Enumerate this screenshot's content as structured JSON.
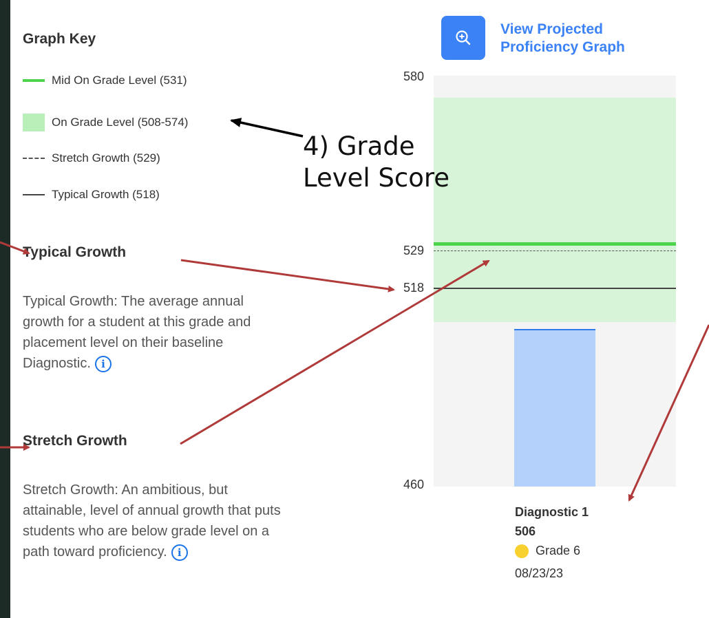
{
  "graph_key": {
    "title": "Graph Key",
    "items": [
      {
        "label": "Mid On Grade Level (531)",
        "swatch": "solid-green"
      },
      {
        "label": "On Grade Level (508-574)",
        "swatch": "green-box"
      },
      {
        "label": "Stretch Growth (529)",
        "swatch": "dashed"
      },
      {
        "label": "Typical Growth (518)",
        "swatch": "solid-dark"
      }
    ]
  },
  "sections": {
    "typical": {
      "title": "Typical Growth",
      "description": "Typical Growth: The average annual growth for a student at this grade and placement level on their baseline Diagnostic."
    },
    "stretch": {
      "title": "Stretch Growth",
      "description": "Stretch Growth: An ambitious, but attainable, level of annual growth that puts students who are below grade level on a path toward proficiency."
    }
  },
  "view_button": {
    "label": "View Projected Proficiency Graph",
    "icon": "zoom-in-icon"
  },
  "chart_data": {
    "type": "bar",
    "categories": [
      "Diagnostic 1"
    ],
    "values": [
      506
    ],
    "ylim": [
      460,
      580
    ],
    "ticks": [
      "580",
      "529",
      "518",
      "460"
    ],
    "reference_lines": [
      {
        "label": "Mid On Grade Level",
        "value": 531
      },
      {
        "label": "Stretch Growth",
        "value": 529
      },
      {
        "label": "Typical Growth",
        "value": 518
      }
    ],
    "band": {
      "label": "On Grade Level",
      "from": 508,
      "to": 574
    }
  },
  "diagnostic": {
    "title": "Diagnostic 1",
    "score": "506",
    "grade": "Grade 6",
    "date": "08/23/23"
  },
  "annotation": {
    "line1": "4) Grade",
    "line2": "Level Score"
  },
  "info_icon": "i",
  "colors": {
    "mid_line": "#4cd44c",
    "band": "#d7f3d8",
    "bar": "#b2d0fa",
    "bar_top": "#2e7be8",
    "accent": "#3b82f6",
    "grade_dot": "#f8d12f",
    "arrow_red": "#b03a3a"
  }
}
